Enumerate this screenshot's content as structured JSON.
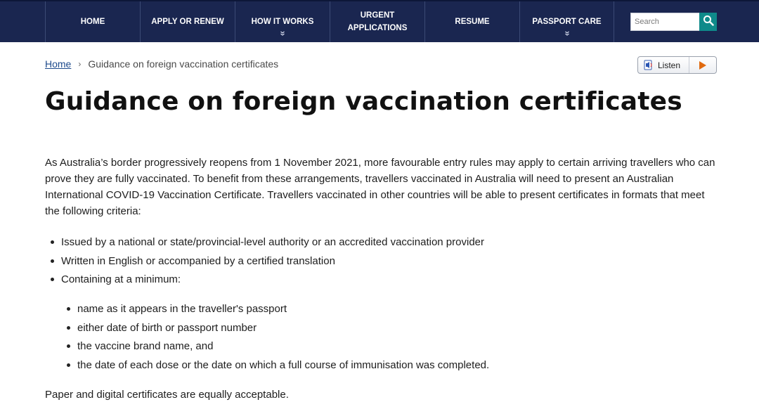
{
  "nav": {
    "items": [
      {
        "label": "HOME"
      },
      {
        "label": "APPLY OR RENEW"
      },
      {
        "label": "HOW IT WORKS",
        "chevron": "double-chevron-down-icon"
      },
      {
        "label": "URGENT APPLICATIONS"
      },
      {
        "label": "RESUME"
      },
      {
        "label": "PASSPORT CARE",
        "chevron": "double-chevron-down-icon"
      }
    ],
    "search": {
      "placeholder": "Search",
      "value": ""
    }
  },
  "breadcrumb": {
    "home_label": "Home",
    "separator": "›",
    "current": "Guidance on foreign vaccination certificates"
  },
  "listen_button": {
    "label": "Listen"
  },
  "page": {
    "title": "Guidance on foreign vaccination certificates",
    "intro": "As Australia’s border progressively reopens from 1 November 2021, more favourable entry rules may apply to certain arriving travellers who can prove they are fully vaccinated. To benefit from these arrangements, travellers vaccinated in Australia will need to present an Australian International COVID-19 Vaccination Certificate. Travellers vaccinated in other countries will be able to present certificates in formats that meet the following criteria:",
    "criteria": [
      "Issued by a national or state/provincial-level authority or an accredited vaccination provider",
      "Written in English or accompanied by a certified translation",
      "Containing at a minimum:"
    ],
    "minimum_items": [
      "name as it appears in the traveller's passport",
      "either date of birth or passport number",
      "the vaccine brand name, and",
      "the date of each dose or the date on which a full course of immunisation was completed."
    ],
    "closing": "Paper and digital certificates are equally acceptable."
  },
  "colors": {
    "header_bg": "#1a2650",
    "search_button": "#0f8a8a",
    "link": "#1d4a8c",
    "play_icon": "#e06a10"
  }
}
